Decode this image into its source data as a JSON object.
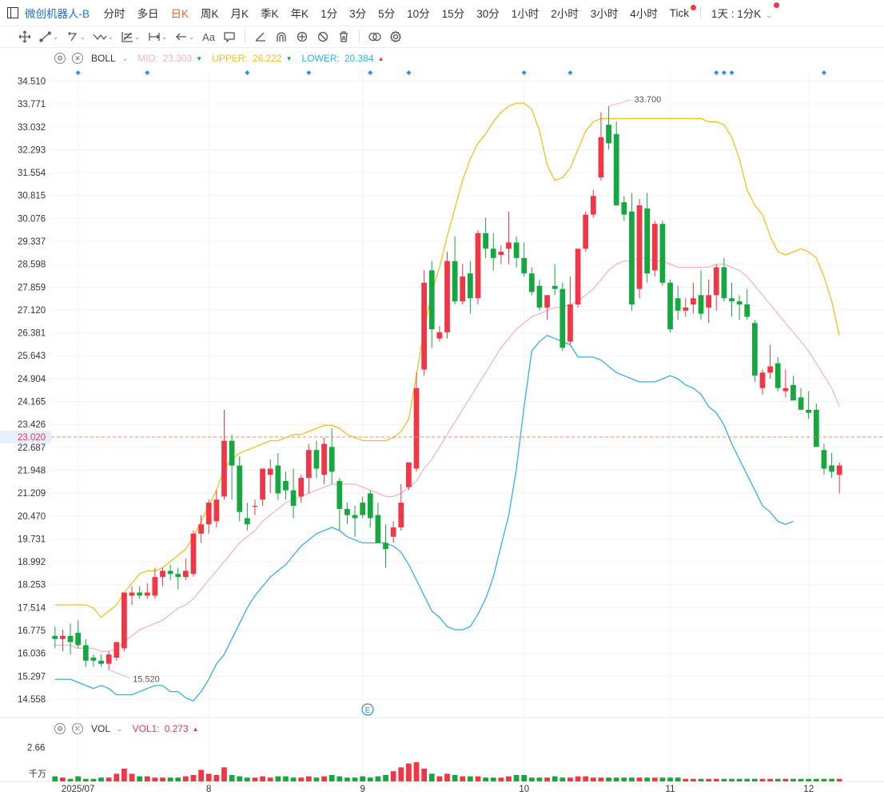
{
  "toolbar": {
    "symbol": "微创机器人-B",
    "periods": [
      "分时",
      "多日",
      "日K",
      "周K",
      "月K",
      "季K",
      "年K",
      "1分",
      "3分",
      "5分",
      "10分",
      "15分",
      "30分",
      "1小时",
      "2小时",
      "3小时",
      "4小时",
      "Tick"
    ],
    "active_period": "日K",
    "interval_label": "1天 : 1分K"
  },
  "indicators": {
    "boll": {
      "name": "BOLL",
      "mid_label": "MID:",
      "mid_value": "23.303",
      "upper_label": "UPPER:",
      "upper_value": "26.222",
      "lower_label": "LOWER:",
      "lower_value": "20.384"
    },
    "vol": {
      "name": "VOL",
      "vol1_label": "VOL1:",
      "vol1_value": "0.273"
    }
  },
  "colors": {
    "up": "#f23645",
    "down": "#14a83e",
    "mid": "#f6b5c0",
    "upper": "#f5c01c",
    "lower": "#33b1e5",
    "last_price": "#ff8a50",
    "marker": "#2a8ff0"
  },
  "chart_data": {
    "type": "candlestick",
    "y_ticks": [
      "34.510",
      "33.771",
      "33.032",
      "32.293",
      "31.554",
      "30.815",
      "30.076",
      "29.337",
      "28.598",
      "27.859",
      "27.120",
      "26.381",
      "25.643",
      "24.904",
      "24.165",
      "23.426",
      "22.687",
      "21.948",
      "21.209",
      "20.470",
      "19.731",
      "18.992",
      "18.253",
      "17.514",
      "16.775",
      "16.036",
      "15.297",
      "14.558"
    ],
    "ylim": [
      14.3,
      34.6
    ],
    "x_labels": [
      {
        "label": "2025/07",
        "index": 3
      },
      {
        "label": "8",
        "index": 20
      },
      {
        "label": "9",
        "index": 40
      },
      {
        "label": "10",
        "index": 61
      },
      {
        "label": "11",
        "index": 80
      },
      {
        "label": "12",
        "index": 98
      }
    ],
    "last_price": "23.020",
    "max_label": "33.700",
    "min_label": "15.520",
    "event_marker": "E",
    "vol_tick": "2.66",
    "vol_unit": "千万",
    "vol_ylim": [
      0,
      3.0
    ],
    "marker_indices": [
      3,
      12,
      25,
      33,
      41,
      46,
      61,
      67,
      86,
      87,
      88,
      100
    ],
    "ohlc": [
      [
        16.6,
        16.9,
        16.2,
        16.5
      ],
      [
        16.5,
        16.8,
        16.1,
        16.6
      ],
      [
        16.6,
        17.0,
        16.0,
        16.4
      ],
      [
        16.7,
        17.1,
        16.2,
        16.3
      ],
      [
        16.3,
        16.5,
        15.6,
        15.8
      ],
      [
        15.9,
        16.0,
        15.6,
        15.8
      ],
      [
        15.8,
        16.0,
        15.6,
        15.7
      ],
      [
        15.7,
        16.1,
        15.5,
        16.0
      ],
      [
        15.9,
        16.4,
        15.8,
        16.4
      ],
      [
        16.2,
        18.0,
        16.1,
        18.0
      ],
      [
        17.9,
        18.2,
        17.6,
        18.0
      ],
      [
        18.0,
        18.2,
        17.8,
        17.9
      ],
      [
        17.9,
        18.3,
        17.8,
        18.0
      ],
      [
        17.9,
        18.8,
        17.8,
        18.5
      ],
      [
        18.5,
        18.8,
        18.2,
        18.7
      ],
      [
        18.7,
        18.9,
        18.4,
        18.6
      ],
      [
        18.6,
        18.8,
        18.1,
        18.5
      ],
      [
        18.5,
        19.1,
        18.4,
        18.7
      ],
      [
        18.6,
        20.0,
        18.5,
        19.9
      ],
      [
        19.9,
        20.5,
        19.6,
        20.2
      ],
      [
        20.2,
        21.0,
        19.9,
        20.9
      ],
      [
        20.3,
        21.3,
        20.1,
        21.0
      ],
      [
        21.1,
        23.9,
        21.0,
        22.9
      ],
      [
        22.9,
        23.1,
        21.0,
        22.1
      ],
      [
        22.1,
        22.4,
        20.3,
        20.6
      ],
      [
        20.4,
        20.9,
        20.0,
        20.2
      ],
      [
        20.8,
        21.0,
        20.5,
        20.8
      ],
      [
        21.0,
        22.0,
        20.8,
        22.0
      ],
      [
        21.8,
        22.3,
        21.2,
        22.0
      ],
      [
        22.1,
        22.5,
        21.0,
        21.2
      ],
      [
        21.6,
        21.9,
        21.0,
        21.3
      ],
      [
        21.3,
        22.0,
        20.4,
        20.8
      ],
      [
        21.1,
        21.8,
        20.9,
        21.7
      ],
      [
        21.7,
        22.8,
        21.2,
        22.6
      ],
      [
        22.6,
        22.9,
        21.7,
        22.0
      ],
      [
        21.8,
        23.0,
        21.5,
        22.8
      ],
      [
        22.7,
        23.3,
        21.5,
        21.9
      ],
      [
        21.6,
        21.7,
        20.0,
        20.7
      ],
      [
        20.7,
        20.9,
        20.2,
        20.5
      ],
      [
        20.5,
        20.8,
        19.8,
        20.4
      ],
      [
        20.9,
        21.1,
        20.4,
        20.5
      ],
      [
        21.2,
        21.3,
        20.1,
        20.4
      ],
      [
        20.5,
        20.9,
        19.7,
        19.6
      ],
      [
        19.6,
        20.2,
        18.8,
        19.4
      ],
      [
        19.8,
        20.3,
        19.6,
        20.1
      ],
      [
        20.1,
        21.5,
        20.0,
        20.9
      ],
      [
        21.4,
        22.0,
        21.3,
        22.2
      ],
      [
        22.0,
        25.1,
        21.9,
        24.6
      ],
      [
        25.2,
        28.4,
        25.0,
        28.0
      ],
      [
        28.4,
        28.7,
        25.9,
        26.5
      ],
      [
        26.2,
        26.6,
        26.1,
        26.4
      ],
      [
        26.4,
        29.0,
        26.2,
        28.7
      ],
      [
        28.7,
        29.5,
        27.3,
        27.4
      ],
      [
        27.4,
        28.6,
        27.3,
        28.2
      ],
      [
        28.3,
        28.7,
        27.0,
        27.5
      ],
      [
        27.5,
        29.7,
        27.3,
        29.6
      ],
      [
        29.6,
        30.1,
        28.8,
        29.1
      ],
      [
        29.1,
        29.6,
        28.4,
        28.8
      ],
      [
        28.9,
        29.2,
        28.6,
        29.0
      ],
      [
        29.1,
        30.3,
        28.6,
        29.3
      ],
      [
        29.3,
        29.5,
        28.5,
        28.8
      ],
      [
        28.8,
        29.3,
        28.2,
        28.3
      ],
      [
        28.3,
        28.5,
        27.6,
        27.7
      ],
      [
        27.9,
        28.1,
        27.1,
        27.2
      ],
      [
        27.2,
        27.6,
        26.8,
        27.6
      ],
      [
        27.9,
        28.6,
        27.6,
        27.8
      ],
      [
        27.8,
        28.0,
        25.8,
        25.9
      ],
      [
        26.1,
        28.2,
        26.0,
        27.3
      ],
      [
        27.3,
        29.0,
        27.2,
        29.1
      ],
      [
        29.1,
        30.3,
        29.0,
        30.2
      ],
      [
        30.2,
        31.0,
        30.1,
        30.8
      ],
      [
        31.4,
        33.5,
        31.3,
        32.7
      ],
      [
        33.1,
        33.7,
        32.3,
        32.5
      ],
      [
        32.8,
        33.2,
        30.7,
        30.5
      ],
      [
        30.6,
        30.8,
        30.0,
        30.2
      ],
      [
        30.3,
        30.9,
        27.1,
        27.3
      ],
      [
        27.8,
        30.7,
        27.5,
        30.5
      ],
      [
        30.4,
        30.9,
        28.0,
        28.3
      ],
      [
        28.4,
        30.0,
        28.2,
        29.9
      ],
      [
        29.9,
        30.0,
        27.9,
        28.0
      ],
      [
        28.0,
        28.1,
        26.4,
        26.5
      ],
      [
        27.5,
        27.9,
        26.8,
        27.1
      ],
      [
        27.1,
        27.5,
        26.9,
        27.2
      ],
      [
        27.3,
        28.0,
        27.0,
        27.5
      ],
      [
        27.6,
        28.4,
        26.8,
        27.0
      ],
      [
        27.2,
        28.1,
        26.7,
        27.6
      ],
      [
        27.6,
        28.6,
        27.1,
        28.5
      ],
      [
        28.5,
        28.8,
        27.4,
        27.5
      ],
      [
        27.5,
        28.0,
        26.9,
        27.4
      ],
      [
        27.4,
        27.6,
        26.8,
        27.3
      ],
      [
        27.3,
        27.8,
        26.8,
        26.9
      ],
      [
        26.7,
        26.8,
        24.8,
        25.0
      ],
      [
        24.6,
        25.2,
        24.4,
        25.1
      ],
      [
        25.1,
        26.0,
        24.9,
        25.3
      ],
      [
        25.4,
        25.6,
        24.5,
        24.6
      ],
      [
        24.5,
        25.2,
        24.3,
        24.6
      ],
      [
        24.7,
        25.0,
        24.3,
        24.2
      ],
      [
        24.3,
        24.6,
        23.9,
        23.9
      ],
      [
        23.9,
        24.5,
        23.6,
        23.8
      ],
      [
        23.9,
        24.1,
        23.0,
        22.7
      ],
      [
        22.6,
        22.8,
        21.8,
        22.0
      ],
      [
        22.1,
        22.5,
        21.7,
        21.9
      ],
      [
        21.8,
        22.2,
        21.2,
        22.1
      ]
    ],
    "boll_mid": [
      16.3,
      16.3,
      16.3,
      16.2,
      16.2,
      16.2,
      16.1,
      16.1,
      16.2,
      16.4,
      16.6,
      16.8,
      16.9,
      17.0,
      17.1,
      17.3,
      17.5,
      17.6,
      17.8,
      18.1,
      18.4,
      18.7,
      19.0,
      19.3,
      19.6,
      19.8,
      20.0,
      20.3,
      20.5,
      20.7,
      20.9,
      21.0,
      21.1,
      21.2,
      21.3,
      21.4,
      21.5,
      21.5,
      21.5,
      21.5,
      21.4,
      21.3,
      21.2,
      21.1,
      21.1,
      21.2,
      21.4,
      21.6,
      22.0,
      22.3,
      22.7,
      23.1,
      23.5,
      23.9,
      24.3,
      24.7,
      25.1,
      25.5,
      25.9,
      26.2,
      26.5,
      26.7,
      26.9,
      27.0,
      27.1,
      27.2,
      27.2,
      27.3,
      27.4,
      27.6,
      27.8,
      28.1,
      28.4,
      28.6,
      28.7,
      28.7,
      28.8,
      28.8,
      28.7,
      28.7,
      28.6,
      28.5,
      28.5,
      28.5,
      28.5,
      28.5,
      28.6,
      28.6,
      28.5,
      28.4,
      28.2,
      27.9,
      27.6,
      27.3,
      27.0,
      26.7,
      26.4,
      26.1,
      25.8,
      25.4,
      25.0,
      24.6,
      24.0
    ],
    "boll_upper": [
      17.6,
      17.6,
      17.6,
      17.6,
      17.6,
      17.5,
      17.2,
      17.4,
      17.6,
      18.0,
      18.3,
      18.6,
      18.7,
      18.7,
      18.8,
      19.0,
      19.2,
      19.4,
      19.8,
      20.3,
      20.8,
      21.3,
      22.0,
      22.3,
      22.5,
      22.6,
      22.7,
      22.8,
      22.9,
      22.9,
      23.0,
      23.1,
      23.1,
      23.2,
      23.3,
      23.4,
      23.4,
      23.3,
      23.1,
      23.0,
      22.9,
      22.9,
      22.9,
      22.9,
      23.0,
      23.2,
      23.6,
      25.0,
      26.5,
      27.7,
      28.5,
      29.5,
      30.4,
      31.3,
      32.0,
      32.5,
      32.8,
      33.2,
      33.5,
      33.7,
      33.8,
      33.8,
      33.6,
      32.9,
      31.8,
      31.3,
      31.4,
      31.7,
      32.3,
      32.9,
      33.2,
      33.3,
      33.3,
      33.3,
      33.3,
      33.3,
      33.3,
      33.3,
      33.3,
      33.3,
      33.3,
      33.3,
      33.3,
      33.3,
      33.3,
      33.2,
      33.2,
      33.1,
      32.7,
      32.0,
      31.0,
      30.5,
      30.2,
      29.5,
      29.0,
      28.9,
      29.0,
      29.1,
      29.0,
      28.8,
      28.2,
      27.4,
      26.3
    ],
    "boll_lower": [
      15.2,
      15.2,
      15.2,
      15.1,
      15.0,
      14.9,
      15.0,
      14.9,
      14.7,
      14.7,
      14.7,
      14.8,
      14.9,
      15.0,
      15.0,
      14.8,
      14.8,
      14.6,
      14.5,
      14.8,
      15.2,
      15.7,
      16.0,
      16.5,
      17.0,
      17.5,
      17.9,
      18.2,
      18.5,
      18.7,
      18.9,
      19.2,
      19.5,
      19.7,
      19.9,
      20.0,
      20.1,
      20.0,
      19.8,
      19.7,
      19.6,
      19.6,
      19.6,
      19.6,
      19.5,
      19.3,
      18.9,
      18.4,
      17.9,
      17.4,
      17.2,
      16.9,
      16.8,
      16.8,
      16.9,
      17.3,
      17.8,
      18.5,
      19.5,
      20.5,
      22.0,
      24.0,
      25.8,
      26.1,
      26.3,
      26.2,
      26.1,
      26.0,
      25.6,
      25.6,
      25.6,
      25.5,
      25.3,
      25.1,
      25.0,
      24.9,
      24.8,
      24.8,
      24.8,
      24.9,
      25.0,
      24.9,
      24.7,
      24.6,
      24.4,
      24.0,
      23.8,
      23.4,
      22.8,
      22.3,
      21.8,
      21.3,
      20.8,
      20.6,
      20.3,
      20.2,
      20.3
    ],
    "volumes": [
      0.4,
      0.3,
      0.2,
      0.4,
      0.2,
      0.2,
      0.3,
      0.3,
      0.6,
      1.0,
      0.6,
      0.4,
      0.4,
      0.3,
      0.3,
      0.3,
      0.3,
      0.4,
      0.5,
      0.9,
      0.6,
      0.5,
      1.1,
      0.5,
      0.4,
      0.3,
      0.3,
      0.4,
      0.3,
      0.4,
      0.4,
      0.3,
      0.3,
      0.4,
      0.3,
      0.4,
      0.5,
      0.4,
      0.3,
      0.3,
      0.4,
      0.3,
      0.4,
      0.5,
      0.8,
      1.1,
      1.4,
      1.5,
      1.0,
      0.6,
      0.4,
      0.6,
      0.5,
      0.4,
      0.4,
      0.4,
      0.3,
      0.3,
      0.3,
      0.4,
      0.5,
      0.5,
      0.3,
      0.3,
      0.3,
      0.4,
      0.3,
      0.3,
      0.4,
      0.4,
      0.3,
      0.3,
      0.3,
      0.3,
      0.3,
      0.3,
      0.3,
      0.3,
      0.3,
      0.3,
      0.3,
      0.3,
      0.2,
      0.2,
      0.2,
      0.2,
      0.2,
      0.2,
      0.2,
      0.2,
      0.2,
      0.2,
      0.2,
      0.2,
      0.2,
      0.2,
      0.2,
      0.2,
      0.2,
      0.2,
      0.2,
      0.2,
      0.2
    ]
  }
}
